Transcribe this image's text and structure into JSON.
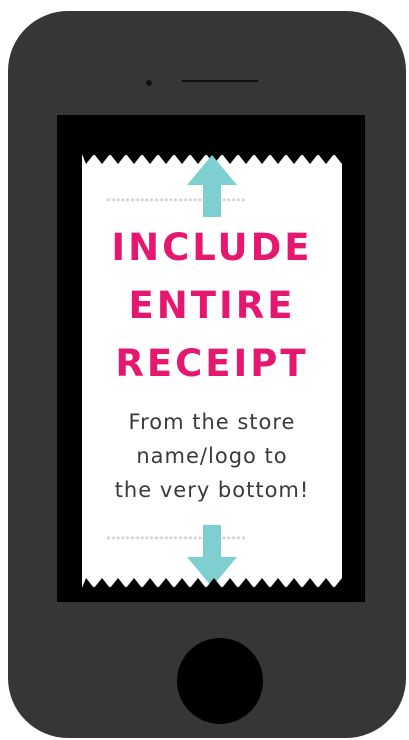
{
  "headline": {
    "line1": "INCLUDE",
    "line2": "ENTIRE",
    "line3": "RECEIPT"
  },
  "subtext": {
    "line1": "From the store",
    "line2": "name/logo to",
    "line3": "the very bottom!"
  },
  "divider": {
    "top": "*****************************",
    "bottom": "*****************************"
  },
  "colors": {
    "phone_body": "#353734",
    "screen": "#000000",
    "receipt": "#ffffff",
    "headline": "#e6176f",
    "arrow": "#7ecfcf",
    "dots": "#b8b8b8"
  },
  "icons": {
    "up": "arrow-up-icon",
    "down": "arrow-down-icon",
    "home": "home-button"
  }
}
